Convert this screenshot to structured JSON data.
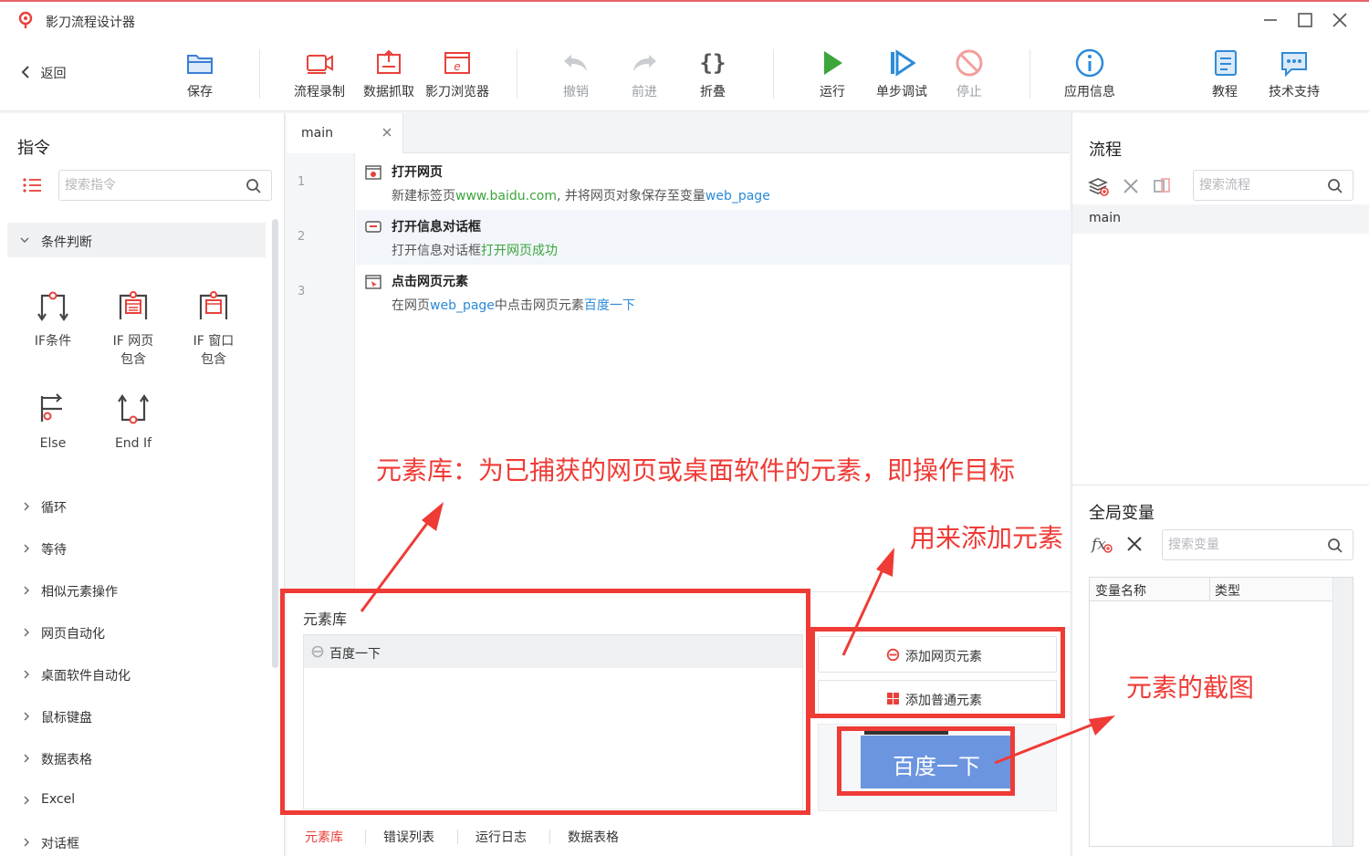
{
  "window": {
    "title": "影刀流程设计器"
  },
  "toolbar": {
    "back": "返回",
    "save": "保存",
    "record": "流程录制",
    "scrape": "数据抓取",
    "browser": "影刀浏览器",
    "undo": "撤销",
    "redo": "前进",
    "fold": "折叠",
    "run": "运行",
    "step_debug": "单步调试",
    "stop": "停止",
    "app_info": "应用信息",
    "tutorial": "教程",
    "support": "技术支持"
  },
  "left_panel": {
    "title": "指令",
    "search_placeholder": "搜索指令",
    "open_category": "条件判断",
    "commands": [
      {
        "label_line1": "IF条件",
        "label_line2": ""
      },
      {
        "label_line1": "IF 网页",
        "label_line2": "包含"
      },
      {
        "label_line1": "IF 窗口",
        "label_line2": "包含"
      },
      {
        "label_line1": "Else",
        "label_line2": ""
      },
      {
        "label_line1": "End If",
        "label_line2": ""
      }
    ],
    "categories": [
      "循环",
      "等待",
      "相似元素操作",
      "网页自动化",
      "桌面软件自动化",
      "鼠标键盘",
      "数据表格",
      "Excel",
      "对话框"
    ]
  },
  "editor": {
    "tab": "main",
    "steps": [
      {
        "line": "1",
        "title": "打开网页",
        "desc_pre": "新建标签页",
        "desc_hl1": "www.baidu.com",
        "desc_mid": ", 并将网页对象保存至变量",
        "desc_hl2": "web_page",
        "desc_post": ""
      },
      {
        "line": "2",
        "title": "打开信息对话框",
        "desc_pre": "打开信息对话框",
        "desc_hl1": "打开网页成功",
        "desc_mid": "",
        "desc_hl2": "",
        "desc_post": ""
      },
      {
        "line": "3",
        "title": "点击网页元素",
        "desc_pre": "在网页",
        "desc_hl1": "web_page",
        "desc_mid": "中点击网页元素",
        "desc_hl2": "百度一下",
        "desc_post": ""
      }
    ]
  },
  "element_library": {
    "title": "元素库",
    "items": [
      "百度一下"
    ],
    "add_web": "添加网页元素",
    "add_normal": "添加普通元素",
    "preview_text": "百度一下",
    "bottom_tabs": [
      "元素库",
      "错误列表",
      "运行日志",
      "数据表格"
    ]
  },
  "right_panel": {
    "flow_title": "流程",
    "flow_search_placeholder": "搜索流程",
    "flows": [
      "main"
    ],
    "vars_title": "全局变量",
    "var_search_placeholder": "搜索变量",
    "var_col_name": "变量名称",
    "var_col_type": "类型"
  },
  "annotations": {
    "library_note": "元素库：为已捕获的网页或桌面软件的元素，即操作目标",
    "add_note": "用来添加元素",
    "screenshot_note": "元素的截图"
  },
  "colors": {
    "accent_red": "#ef3b36",
    "run_green": "#3ca53c",
    "link_blue": "#2b8ad8",
    "title_accent": "#e8626a"
  }
}
